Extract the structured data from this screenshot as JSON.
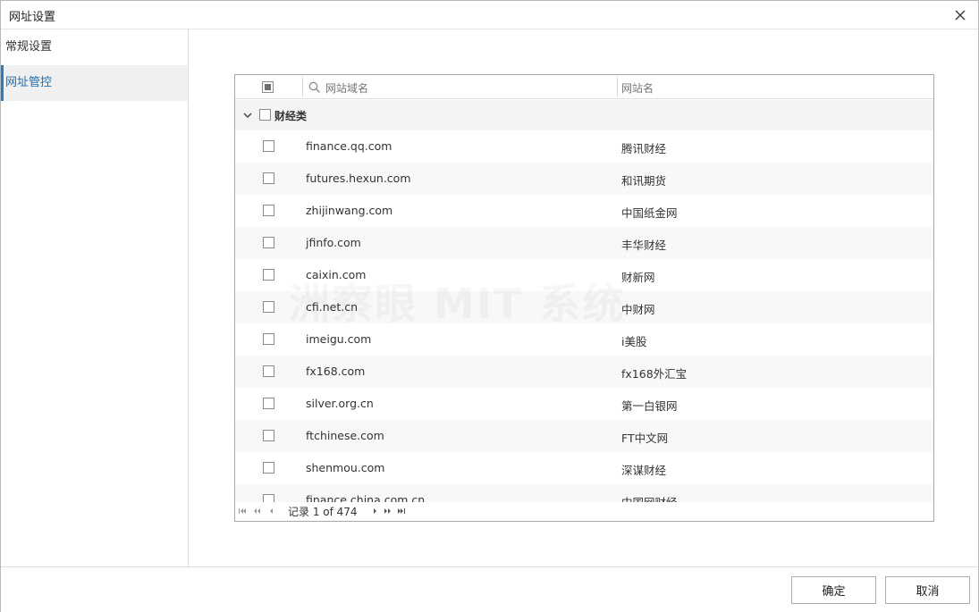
{
  "window": {
    "title": "网址设置"
  },
  "sidebar": {
    "items": [
      {
        "label": "常规设置",
        "active": false
      },
      {
        "label": "网址管控",
        "active": true
      }
    ]
  },
  "grid": {
    "columns": {
      "domain_placeholder": "网站域名",
      "site_name": "网站名"
    },
    "group": {
      "label": "财经类",
      "expanded": true
    },
    "rows": [
      {
        "domain": "finance.qq.com",
        "name": "腾讯财经"
      },
      {
        "domain": "futures.hexun.com",
        "name": "和讯期货"
      },
      {
        "domain": "zhijinwang.com",
        "name": "中国纸金网"
      },
      {
        "domain": "jfinfo.com",
        "name": "丰华财经"
      },
      {
        "domain": "caixin.com",
        "name": "财新网"
      },
      {
        "domain": "cfi.net.cn",
        "name": "中财网"
      },
      {
        "domain": "imeigu.com",
        "name": "i美股"
      },
      {
        "domain": "fx168.com",
        "name": "fx168外汇宝"
      },
      {
        "domain": "silver.org.cn",
        "name": "第一白银网"
      },
      {
        "domain": "ftchinese.com",
        "name": "FT中文网"
      },
      {
        "domain": "shenmou.com",
        "name": "深谋财经"
      },
      {
        "domain": "finance.china.com.cn",
        "name": "中国网财经"
      }
    ],
    "pager": {
      "record_text": "记录 1 of 474"
    }
  },
  "watermark": "洲察眼 MIT 系统",
  "footer": {
    "ok_label": "确定",
    "cancel_label": "取消"
  },
  "colors": {
    "accent": "#1e7fd0",
    "active_text": "#1a6fb5"
  }
}
